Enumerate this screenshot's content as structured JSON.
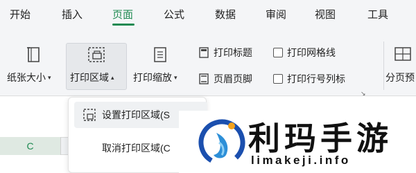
{
  "menu": {
    "tabs": [
      {
        "label": "开始"
      },
      {
        "label": "插入"
      },
      {
        "label": "页面"
      },
      {
        "label": "公式"
      },
      {
        "label": "数据"
      },
      {
        "label": "审阅"
      },
      {
        "label": "视图"
      },
      {
        "label": "工具"
      }
    ],
    "active_tab": "页面",
    "accent_color": "#1f8a52"
  },
  "ribbon": {
    "paper_size": "纸张大小",
    "print_area": "打印区域",
    "print_scale": "打印缩放",
    "print_titles": "打印标题",
    "header_footer": "页眉页脚",
    "print_gridlines": "打印网格线",
    "print_row_col_headers": "打印行号列标",
    "page_break_preview": "分页预",
    "dialog_launcher": "↘"
  },
  "dropdown": {
    "set_print_area": "设置打印区域(S",
    "clear_print_area": "取消打印区域(C"
  },
  "sheet": {
    "column_label": "C"
  },
  "logo": {
    "title": "利玛手游",
    "url": "limakeji.info"
  }
}
